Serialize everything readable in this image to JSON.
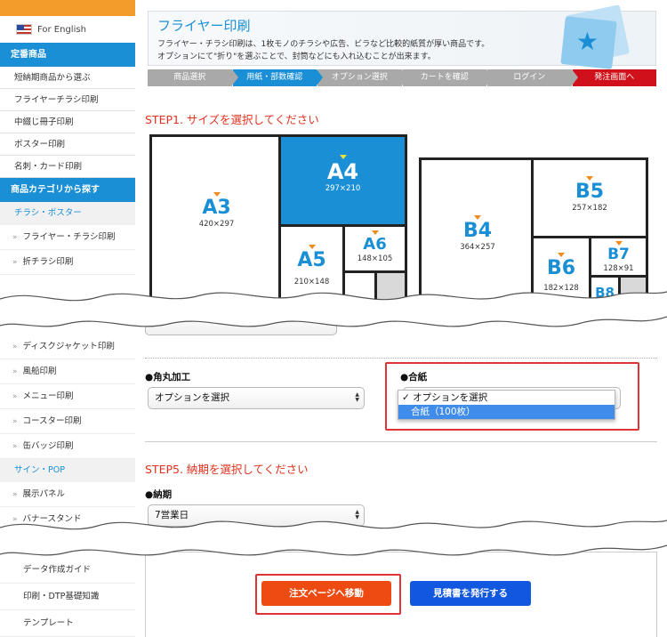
{
  "sidebar": {
    "english": "For English",
    "heading1": "定番商品",
    "items1": [
      "短納期商品から選ぶ",
      "フライヤーチラシ印刷",
      "中綴じ冊子印刷",
      "ポスター印刷",
      "名刺・カード印刷"
    ],
    "heading2": "商品カテゴリから探す",
    "sub1": "チラシ・ポスター",
    "children1": [
      "フライヤー・チラシ印刷",
      "折チラシ印刷"
    ],
    "children2": [
      "ディスクジャケット印刷",
      "風船印刷",
      "メニュー印刷",
      "コースター印刷",
      "缶バッジ印刷"
    ],
    "sub2": "サイン・POP",
    "children3": [
      "展示パネル",
      "バナースタンド"
    ],
    "bottom": [
      "データ作成ガイド",
      "印刷・DTP基礎知識",
      "テンプレート"
    ]
  },
  "banner": {
    "title": "フライヤー印刷",
    "line1": "フライヤー・チラシ印刷は、1枚モノのチラシや広告、ビラなど比較的紙質が厚い商品です。",
    "line2": "オプションにて\"折り\"を選ぶことで、封筒などにも入れ込むことが出来ます。"
  },
  "steps": [
    "商品選択",
    "用紙・部数確認",
    "オプション選択",
    "カートを確認",
    "ログイン",
    "発注画面へ"
  ],
  "step1_title": "STEP1. サイズを選択してください",
  "papers": {
    "a3": {
      "name": "A3",
      "dim": "420×297"
    },
    "a4": {
      "name": "A4",
      "dim": "297×210"
    },
    "a5": {
      "name": "A5",
      "dim": "210×148"
    },
    "a6": {
      "name": "A6",
      "dim": "148×105"
    },
    "b4": {
      "name": "B4",
      "dim": "364×257"
    },
    "b5": {
      "name": "B5",
      "dim": "257×182"
    },
    "b6": {
      "name": "B6",
      "dim": "182×128"
    },
    "b7": {
      "name": "B7",
      "dim": "128×91"
    },
    "b8": {
      "name": "B8"
    }
  },
  "options": {
    "corner_label": "●角丸加工",
    "corner_value": "オプションを選択",
    "gouhi_label": "●合紙",
    "gouhi_options": [
      "オプションを選択",
      "合紙（100枚）"
    ]
  },
  "step5_title": "STEP5. 納期を選択してください",
  "deadline": {
    "label": "●納期",
    "value": "7営業日"
  },
  "buttons": {
    "order": "注文ページへ移動",
    "quote": "見積書を発行する"
  },
  "colors": {
    "brand_blue": "#1a8fd6",
    "accent_red": "#e0311e",
    "order_orange": "#ee4b12",
    "quote_blue": "#1257e0"
  }
}
